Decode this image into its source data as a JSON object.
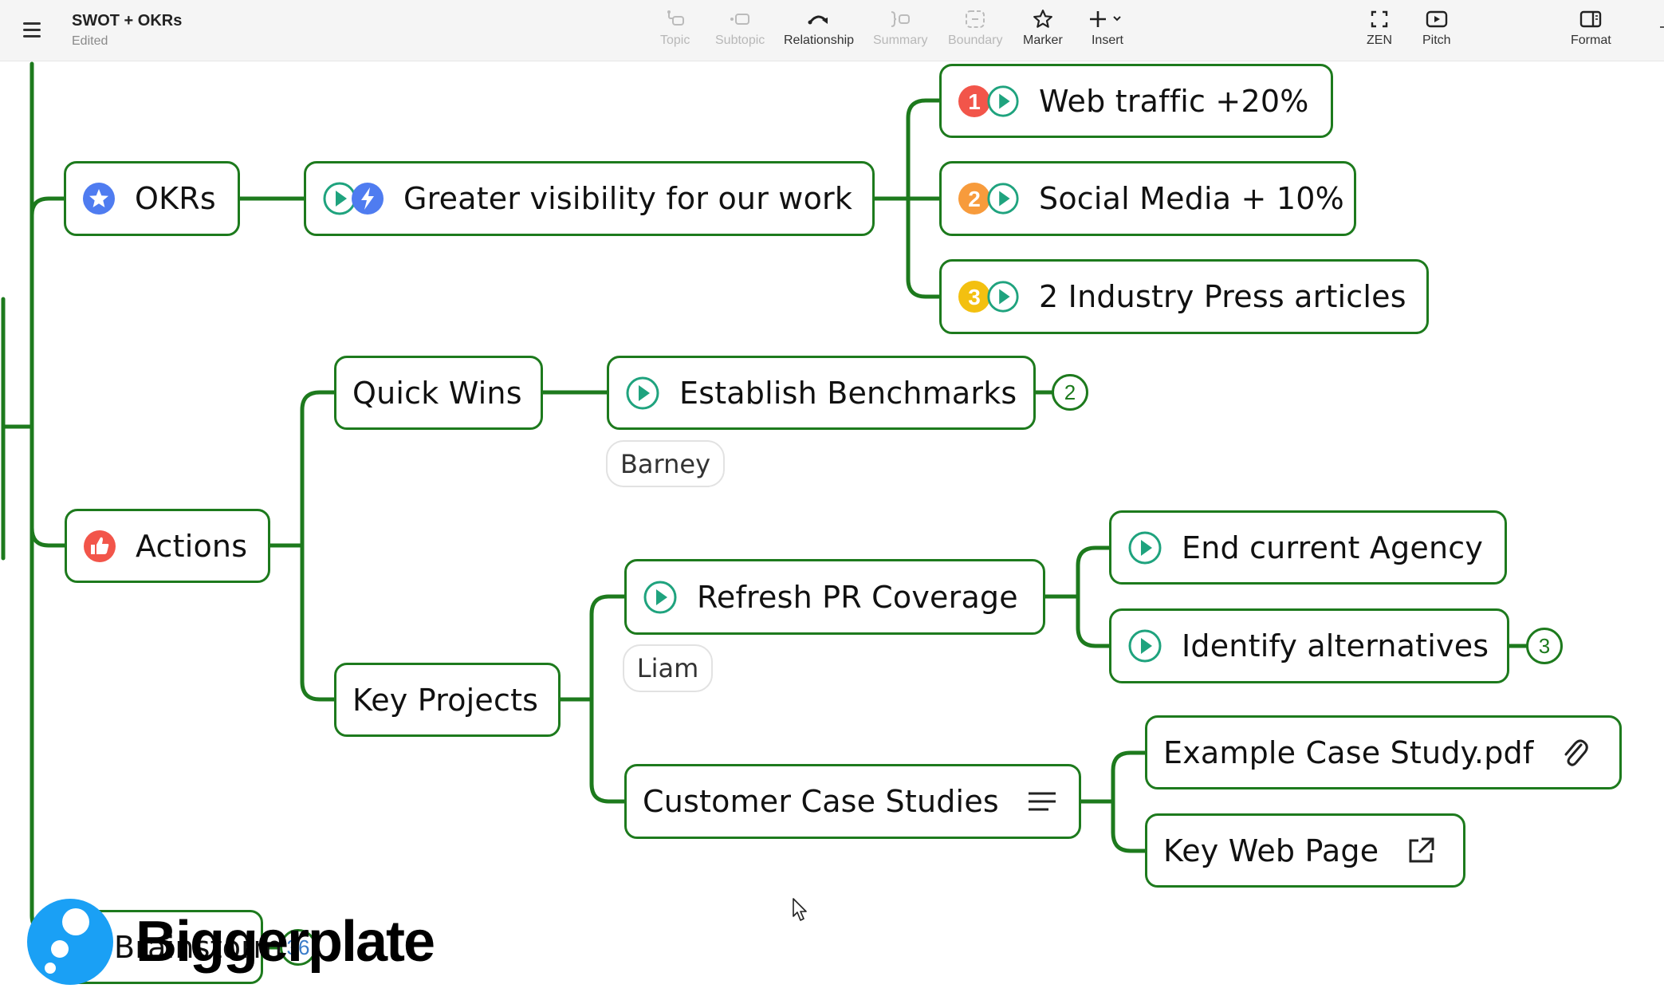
{
  "header": {
    "title": "SWOT + OKRs",
    "status": "Edited",
    "menu_icon": "hamburger-menu-icon"
  },
  "toolbar": {
    "tools": [
      {
        "id": "topic",
        "label": "Topic",
        "icon": "topic-icon",
        "enabled": false
      },
      {
        "id": "subtopic",
        "label": "Subtopic",
        "icon": "subtopic-icon",
        "enabled": false
      },
      {
        "id": "relationship",
        "label": "Relationship",
        "icon": "relationship-arrow-icon",
        "enabled": true
      },
      {
        "id": "summary",
        "label": "Summary",
        "icon": "summary-brace-icon",
        "enabled": false
      },
      {
        "id": "boundary",
        "label": "Boundary",
        "icon": "boundary-icon",
        "enabled": false
      },
      {
        "id": "marker",
        "label": "Marker",
        "icon": "star-icon",
        "enabled": true
      },
      {
        "id": "insert",
        "label": "Insert",
        "icon": "plus-icon",
        "enabled": true,
        "has_dropdown": true
      }
    ],
    "right_tools": [
      {
        "id": "zen",
        "label": "ZEN",
        "icon": "fullscreen-icon"
      },
      {
        "id": "pitch",
        "label": "Pitch",
        "icon": "play-screen-icon"
      },
      {
        "id": "format",
        "label": "Format",
        "icon": "format-panel-icon"
      }
    ]
  },
  "colors": {
    "branch": "#1d7a1d",
    "marker_blue": "#4f7cf0",
    "marker_red": "#f2554a",
    "marker_orange": "#f79b3c",
    "marker_yellow": "#f3c010",
    "task_green": "#1fa37e",
    "toolbar_bg": "#f5f5f5"
  },
  "mindmap": {
    "okrs": {
      "label": "OKRs",
      "markers": [
        "star-marker"
      ],
      "children": [
        {
          "label": "Greater visibility for our work",
          "markers": [
            "task-start",
            "priority-lightning"
          ],
          "children": [
            {
              "label": "Web traffic +20%",
              "markers": [
                "priority-1",
                "task-start"
              ]
            },
            {
              "label": "Social Media + 10%",
              "markers": [
                "priority-2",
                "task-start"
              ]
            },
            {
              "label": "2 Industry Press articles",
              "markers": [
                "priority-3",
                "task-start"
              ]
            }
          ]
        }
      ]
    },
    "actions": {
      "label": "Actions",
      "markers": [
        "thumbs-up"
      ],
      "quick_wins": {
        "label": "Quick Wins",
        "establish": {
          "label": "Establish Benchmarks",
          "markers": [
            "task-start"
          ],
          "tag": "Barney",
          "collapsed_count": "2"
        }
      },
      "key_projects": {
        "label": "Key Projects",
        "refresh": {
          "label": "Refresh PR Coverage",
          "markers": [
            "task-start"
          ],
          "tag": "Liam",
          "children": [
            {
              "label": "End current Agency",
              "markers": [
                "task-start"
              ]
            },
            {
              "label": "Identify alternatives",
              "markers": [
                "task-start"
              ],
              "collapsed_count": "3"
            }
          ]
        },
        "case_studies": {
          "label": "Customer Case Studies",
          "note_icon": "notes-icon",
          "children": [
            {
              "label": "Example Case Study.pdf",
              "icon": "attachment-icon"
            },
            {
              "label": "Key Web Page",
              "icon": "external-link-icon"
            }
          ]
        }
      }
    },
    "brainstorm": {
      "label": "Brainstorm",
      "collapsed_count": "36"
    }
  },
  "watermark": {
    "text": "Biggerplate"
  }
}
